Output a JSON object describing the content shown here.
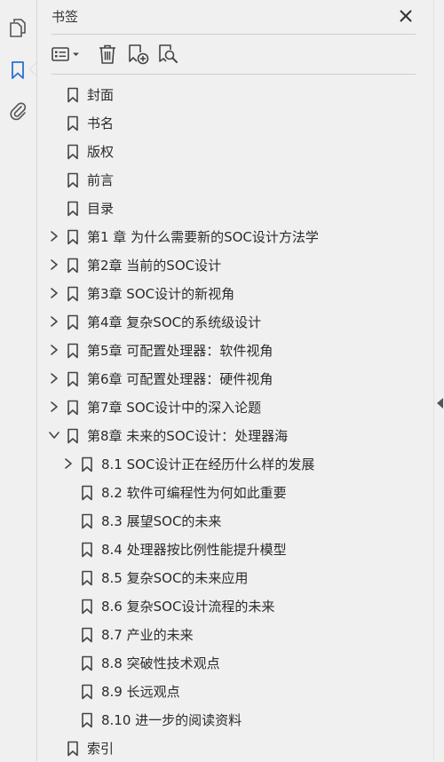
{
  "panel": {
    "title": "书签"
  },
  "rail": {
    "icons": [
      "pages-icon",
      "bookmark-icon",
      "attachment-icon"
    ],
    "active": "bookmark-icon",
    "accent_color": "#2d6fd6"
  },
  "toolbar": {
    "icons": [
      "options-menu-icon",
      "delete-icon",
      "new-bookmark-icon",
      "bookmark-search-icon"
    ]
  },
  "bookmarks": [
    {
      "label": "封面",
      "level": 0,
      "expander": "none"
    },
    {
      "label": "书名",
      "level": 0,
      "expander": "none"
    },
    {
      "label": "版权",
      "level": 0,
      "expander": "none"
    },
    {
      "label": "前言",
      "level": 0,
      "expander": "none"
    },
    {
      "label": "目录",
      "level": 0,
      "expander": "none"
    },
    {
      "label": "第1 章 为什么需要新的SOC设计方法学",
      "level": 0,
      "expander": "collapsed"
    },
    {
      "label": "第2章 当前的SOC设计",
      "level": 0,
      "expander": "collapsed"
    },
    {
      "label": "第3章 SOC设计的新视角",
      "level": 0,
      "expander": "collapsed"
    },
    {
      "label": "第4章 复杂SOC的系统级设计",
      "level": 0,
      "expander": "collapsed"
    },
    {
      "label": "第5章 可配置处理器：软件视角",
      "level": 0,
      "expander": "collapsed"
    },
    {
      "label": "第6章 可配置处理器：硬件视角",
      "level": 0,
      "expander": "collapsed"
    },
    {
      "label": "第7章 SOC设计中的深入论题",
      "level": 0,
      "expander": "collapsed"
    },
    {
      "label": "第8章 未来的SOC设计：处理器海",
      "level": 0,
      "expander": "expanded"
    },
    {
      "label": "8.1 SOC设计正在经历什么样的发展",
      "level": 1,
      "expander": "collapsed"
    },
    {
      "label": "8.2 软件可编程性为何如此重要",
      "level": 1,
      "expander": "none"
    },
    {
      "label": "8.3 展望SOC的未来",
      "level": 1,
      "expander": "none"
    },
    {
      "label": "8.4 处理器按比例性能提升模型",
      "level": 1,
      "expander": "none"
    },
    {
      "label": "8.5 复杂SOC的未来应用",
      "level": 1,
      "expander": "none"
    },
    {
      "label": "8.6 复杂SOC设计流程的未来",
      "level": 1,
      "expander": "none"
    },
    {
      "label": "8.7 产业的未来",
      "level": 1,
      "expander": "none"
    },
    {
      "label": "8.8 突破性技术观点",
      "level": 1,
      "expander": "none"
    },
    {
      "label": "8.9 长远观点",
      "level": 1,
      "expander": "none"
    },
    {
      "label": "8.10 进一步的阅读资料",
      "level": 1,
      "expander": "none"
    },
    {
      "label": "索引",
      "level": 0,
      "expander": "none"
    }
  ]
}
